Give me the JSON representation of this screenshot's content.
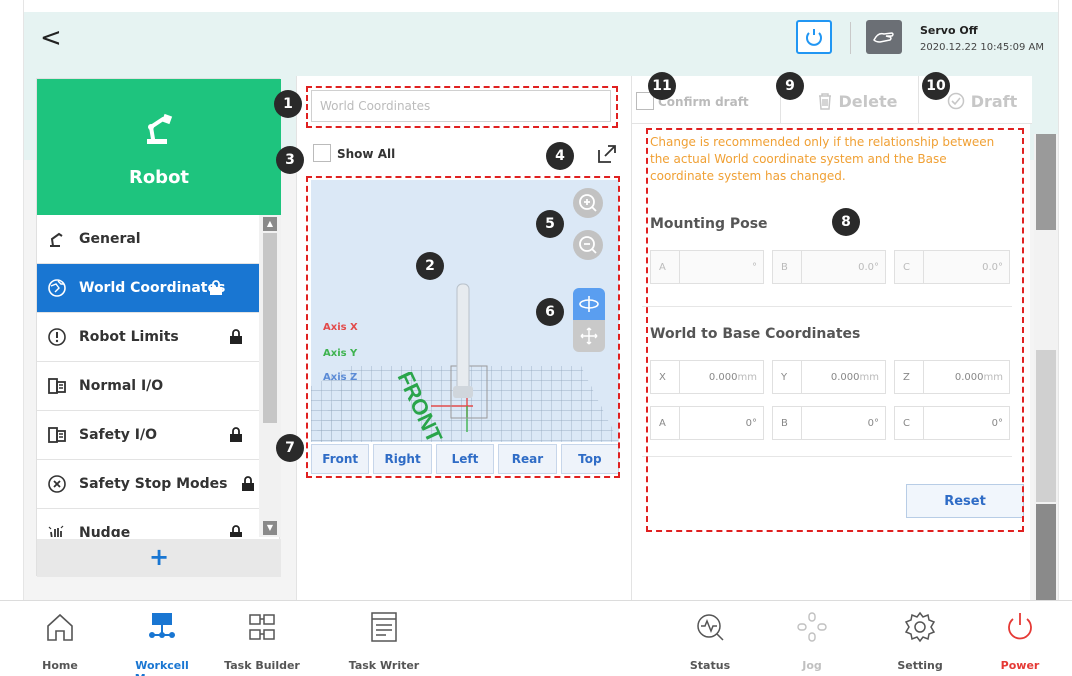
{
  "header": {
    "back_glyph": "<",
    "servo_status": "Servo Off",
    "datetime": "2020.12.22 10:45:09 AM"
  },
  "robot_panel": {
    "title": "Robot",
    "add_glyph": "+",
    "items": [
      {
        "label": "General",
        "locked": false,
        "active": false,
        "icon": "robot-arm-icon"
      },
      {
        "label": "World Coordinates",
        "locked": true,
        "active": true,
        "icon": "globe-icon"
      },
      {
        "label": "Robot Limits",
        "locked": true,
        "active": false,
        "icon": "limit-icon"
      },
      {
        "label": "Normal I/O",
        "locked": false,
        "active": false,
        "icon": "io-icon"
      },
      {
        "label": "Safety I/O",
        "locked": true,
        "active": false,
        "icon": "io-icon"
      },
      {
        "label": "Safety Stop Modes",
        "locked": true,
        "active": false,
        "icon": "stop-icon"
      },
      {
        "label": "Nudge",
        "locked": true,
        "active": false,
        "icon": "hand-icon"
      }
    ]
  },
  "coord_panel": {
    "name_placeholder": "World Coordinates",
    "show_all_label": "Show All",
    "axis_x": "Axis X",
    "axis_y": "Axis Y",
    "axis_z": "Axis Z",
    "floor_label": "FRONT",
    "view_buttons": [
      "Front",
      "Right",
      "Left",
      "Rear",
      "Top"
    ]
  },
  "toolbar": {
    "confirm_label": "Confirm draft",
    "delete_label": "Delete",
    "draft_label": "Draft"
  },
  "settings": {
    "warning": "Change is recommended only if the relationship between the actual World coordinate system and the Base coordinate system has changed.",
    "mounting_pose_title": "Mounting Pose",
    "mounting_pose": [
      {
        "label": "A",
        "value": "°"
      },
      {
        "label": "B",
        "value": "0.0°"
      },
      {
        "label": "C",
        "value": "0.0°"
      }
    ],
    "world_to_base_title": "World to Base Coordinates",
    "world_to_base_row1": [
      {
        "label": "X",
        "value": "0.000",
        "unit": "mm"
      },
      {
        "label": "Y",
        "value": "0.000",
        "unit": "mm"
      },
      {
        "label": "Z",
        "value": "0.000",
        "unit": "mm"
      }
    ],
    "world_to_base_row2": [
      {
        "label": "A",
        "value": "0°"
      },
      {
        "label": "B",
        "value": "0°"
      },
      {
        "label": "C",
        "value": "0°"
      }
    ],
    "reset_label": "Reset"
  },
  "markers": [
    "1",
    "2",
    "3",
    "4",
    "5",
    "6",
    "7",
    "8",
    "9",
    "10",
    "11"
  ],
  "bottom_nav": [
    {
      "label": "Home",
      "active": false
    },
    {
      "label": "Workcell Manager",
      "active": true
    },
    {
      "label": "Task Builder",
      "active": false
    },
    {
      "label": "Task Writer",
      "active": false
    },
    {
      "label": "Status",
      "active": false
    },
    {
      "label": "Jog",
      "active": false,
      "disabled": true
    },
    {
      "label": "Setting",
      "active": false
    },
    {
      "label": "Power",
      "active": false,
      "danger": true
    }
  ],
  "colors": {
    "accent_blue": "#1976d2",
    "robot_green": "#1ec47e",
    "warning_orange": "#f0a034",
    "callout_red": "#e02020",
    "power_red": "#e53935"
  }
}
